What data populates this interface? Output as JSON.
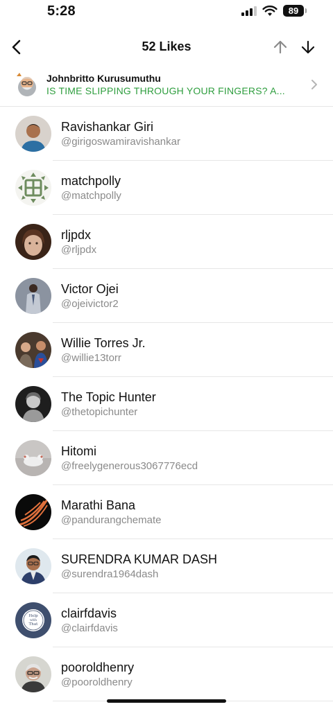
{
  "status_bar": {
    "time": "5:28",
    "battery": "89",
    "icons": [
      "signal-icon",
      "wifi-icon",
      "battery-icon"
    ]
  },
  "nav": {
    "title": "52 Likes",
    "back_icon": "chevron-left-icon",
    "up_icon": "arrow-up-icon",
    "down_icon": "arrow-down-icon"
  },
  "post": {
    "author": "Johnbritto Kurusumuthu",
    "text": "IS TIME SLIPPING THROUGH YOUR FINGERS? A...",
    "text_color": "#2f9e3f",
    "chevron_icon": "chevron-right-icon"
  },
  "likes": [
    {
      "name": "Ravishankar Giri",
      "handle": "@girigoswamiravishankar"
    },
    {
      "name": "matchpolly",
      "handle": "@matchpolly"
    },
    {
      "name": "rljpdx",
      "handle": "@rljpdx"
    },
    {
      "name": "Victor Ojei",
      "handle": "@ojeivictor2"
    },
    {
      "name": "Willie Torres Jr.",
      "handle": "@willie13torr"
    },
    {
      "name": "The Topic Hunter",
      "handle": "@thetopichunter"
    },
    {
      "name": "Hitomi",
      "handle": "@freelygenerous3067776ecd"
    },
    {
      "name": "Marathi Bana",
      "handle": "@pandurangchemate"
    },
    {
      "name": "SURENDRA KUMAR DASH",
      "handle": "@surendra1964dash"
    },
    {
      "name": "clairfdavis",
      "handle": "@clairfdavis"
    },
    {
      "name": "pooroldhenry",
      "handle": "@pooroldhenry"
    }
  ],
  "avatar_badges": {
    "clairfdavis_line1": "Help",
    "clairfdavis_line2": "with",
    "clairfdavis_line3": "That"
  }
}
